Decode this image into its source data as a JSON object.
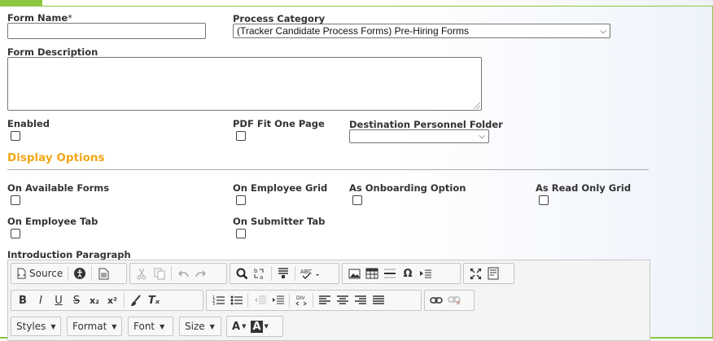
{
  "form": {
    "form_name_label": "Form Name",
    "required_marker": "*",
    "form_name_value": "",
    "process_category_label": "Process Category",
    "process_category_value": "(Tracker Candidate Process Forms) Pre-Hiring Forms",
    "form_description_label": "Form Description",
    "form_description_value": "",
    "enabled_label": "Enabled",
    "pdf_fit_label": "PDF Fit One Page",
    "destination_folder_label": "Destination Personnel Folder",
    "destination_folder_value": ""
  },
  "display_options": {
    "heading": "Display Options",
    "on_available_forms": "On Available Forms",
    "on_employee_grid": "On Employee Grid",
    "as_onboarding_option": "As Onboarding Option",
    "as_read_only_grid": "As Read Only Grid",
    "on_employee_tab": "On Employee Tab",
    "on_submitter_tab": "On Submitter Tab"
  },
  "editor": {
    "intro_label": "Introduction Paragraph",
    "source_label": "Source",
    "styles_label": "Styles",
    "format_label": "Format",
    "font_label": "Font",
    "size_label": "Size",
    "glyphs": {
      "bold": "B",
      "italic": "I",
      "underline": "U",
      "strike": "S",
      "subscript": "x₂",
      "superscript": "x²",
      "remove_format": "Tₓ",
      "omega": "Ω",
      "text_color": "A",
      "bg_color": "A",
      "div": "DIV"
    }
  },
  "colors": {
    "accent_green": "#8dc63f",
    "section_orange": "#f0a814"
  }
}
